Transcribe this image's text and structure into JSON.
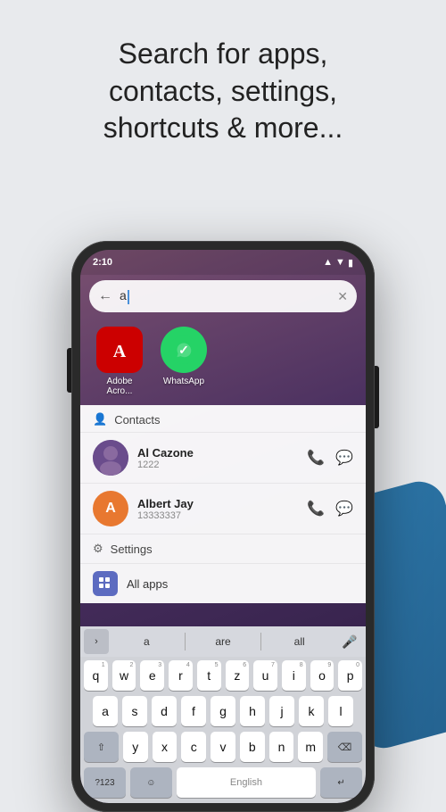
{
  "header": {
    "line1": "Search for apps,",
    "line2": "contacts, settings,",
    "line3": "shortcuts & more..."
  },
  "phone": {
    "status_time": "2:10",
    "search_value": "a",
    "apps": [
      {
        "name": "Adobe Acro...",
        "icon": "adobe",
        "icon_text": "A"
      },
      {
        "name": "WhatsApp",
        "icon": "whatsapp",
        "icon_text": "✓"
      }
    ],
    "sections": {
      "contacts_label": "Contacts",
      "contacts": [
        {
          "name": "Al Cazone",
          "number": "1222",
          "avatar_type": "image",
          "avatar_letter": ""
        },
        {
          "name": "Albert Jay",
          "number": "13333337",
          "avatar_type": "letter",
          "avatar_letter": "A"
        }
      ],
      "settings_label": "Settings",
      "allapps_label": "All apps"
    },
    "keyboard": {
      "suggestions": [
        "a",
        "are",
        "all"
      ],
      "rows": [
        [
          "q",
          "w",
          "e",
          "r",
          "t",
          "z",
          "u",
          "i",
          "o",
          "p"
        ],
        [
          "a",
          "s",
          "d",
          "f",
          "g",
          "h",
          "j",
          "k",
          "l"
        ],
        [
          "⇧",
          "y",
          "x",
          "c",
          "v",
          "b",
          "n",
          "m",
          "⌫"
        ]
      ]
    }
  }
}
